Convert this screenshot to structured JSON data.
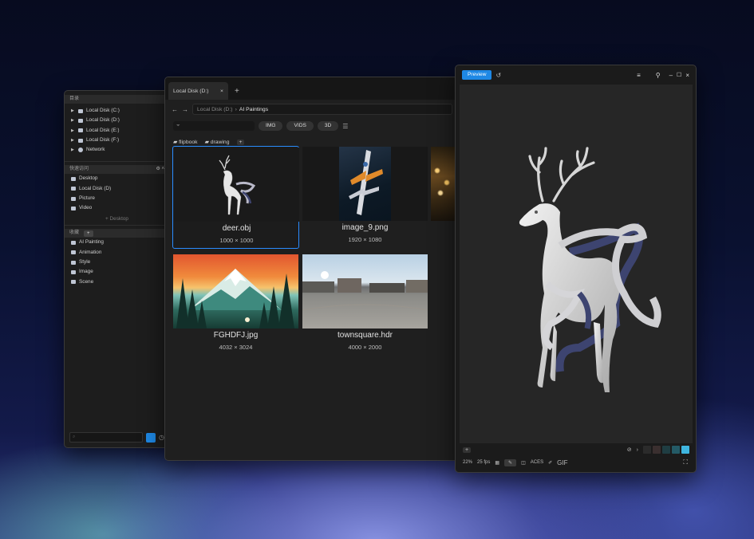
{
  "sidebar": {
    "section1_title": "目录",
    "drives": [
      "Local Disk (C:)",
      "Local Disk (D:)",
      "Local Disk (E:)",
      "Local Disk (F:)",
      "Network"
    ],
    "section2_title": "快速访问",
    "quick": [
      "Desktop",
      "Local Disk (D)",
      "Picture",
      "Video"
    ],
    "add_quick": "+ Desktop",
    "section3_title": "收藏",
    "favorites": [
      "AI Painting",
      "Animation",
      "Style",
      "Image",
      "Scene"
    ]
  },
  "browser": {
    "tab_label": "Local Disk (D:)",
    "address_parent": "Local Disk (D:)",
    "address_current": "AI Paintings",
    "filters": [
      "IMG",
      "VIDS",
      "3D"
    ],
    "folders": [
      "flipbook",
      "drawing"
    ],
    "files": [
      {
        "name": "deer.obj",
        "dim": "1000 × 1000"
      },
      {
        "name": "image_9.png",
        "dim": "1920 × 1080"
      },
      {
        "name": "FGHDFJ.jpg",
        "dim": "4032 × 3024"
      },
      {
        "name": "townsquare.hdr",
        "dim": "4000 × 2000"
      }
    ]
  },
  "preview": {
    "tab_label": "Preview",
    "zoom": "22%",
    "fps": "25 fps",
    "aces": "ACES",
    "gif": "GIF",
    "swatches": [
      "#2b2b2b",
      "#3a2f2f",
      "#1f3d42",
      "#245a66",
      "#3fb6e0"
    ]
  },
  "colors": {
    "accent": "#1e88e5",
    "selection": "#2a8cff"
  }
}
